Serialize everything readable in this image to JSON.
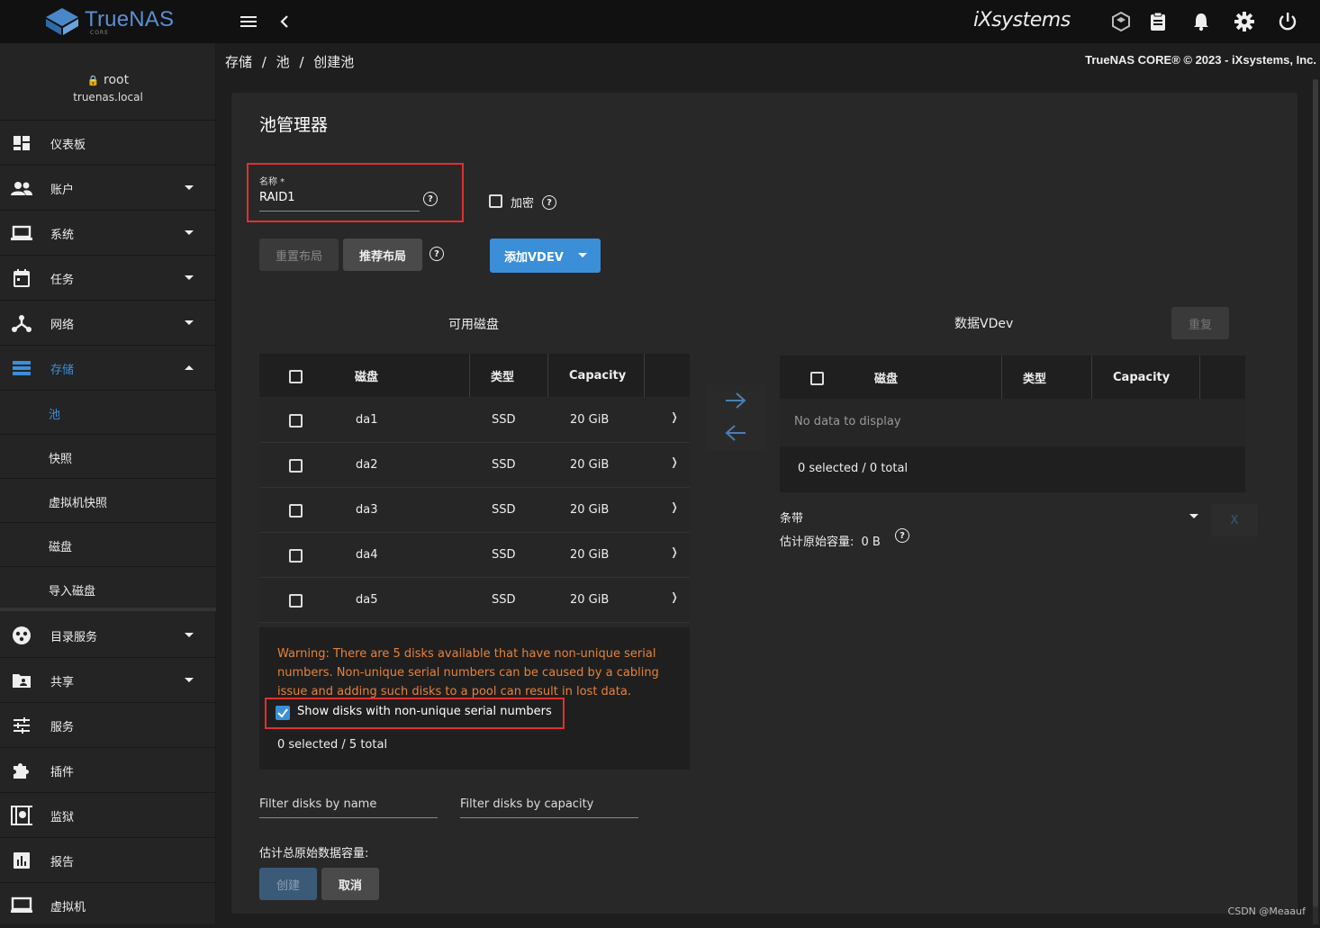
{
  "app": {
    "logo_text": "TrueNAS",
    "logo_sub": "CORE",
    "vendor_logo": "iXsystems",
    "copyright": "TrueNAS CORE® © 2023 - iXsystems, Inc."
  },
  "colors": {
    "accent": "#3b8fd9",
    "warning": "#e5823d",
    "highlight_box": "#e03030"
  },
  "topbar": {
    "icons": [
      "menu-icon",
      "chevron-left-icon",
      "truecommand-icon",
      "clipboard-icon",
      "bell-icon",
      "gear-icon",
      "power-icon"
    ]
  },
  "user": {
    "name": "root",
    "host": "truenas.local"
  },
  "sidebar": {
    "items": [
      {
        "label": "仪表板",
        "icon": "dashboard-icon",
        "expandable": false
      },
      {
        "label": "账户",
        "icon": "people-icon",
        "expandable": true
      },
      {
        "label": "系统",
        "icon": "laptop-icon",
        "expandable": true
      },
      {
        "label": "任务",
        "icon": "calendar-icon",
        "expandable": true
      },
      {
        "label": "网络",
        "icon": "network-icon",
        "expandable": true
      },
      {
        "label": "存储",
        "icon": "storage-icon",
        "expandable": true,
        "expanded": true
      }
    ],
    "storage_sub": [
      "池",
      "快照",
      "虚拟机快照",
      "磁盘",
      "导入磁盘"
    ],
    "items2": [
      {
        "label": "目录服务",
        "icon": "directory-icon",
        "expandable": true
      },
      {
        "label": "共享",
        "icon": "folder-share-icon",
        "expandable": true
      },
      {
        "label": "服务",
        "icon": "tune-icon",
        "expandable": false
      },
      {
        "label": "插件",
        "icon": "puzzle-icon",
        "expandable": false
      },
      {
        "label": "监狱",
        "icon": "jail-icon",
        "expandable": false
      },
      {
        "label": "报告",
        "icon": "chart-icon",
        "expandable": false
      },
      {
        "label": "虚拟机",
        "icon": "monitor-icon",
        "expandable": false
      }
    ]
  },
  "breadcrumb": {
    "parts": [
      "存储",
      "池",
      "创建池"
    ],
    "sep": "/"
  },
  "pool": {
    "title": "池管理器",
    "name_label": "名称 *",
    "name_value": "RAID1",
    "encrypt_label": "加密",
    "reset_layout": "重置布局",
    "suggest_layout": "推荐布局",
    "add_vdev": "添加VDEV"
  },
  "available": {
    "title": "可用磁盘",
    "headers": [
      "磁盘",
      "类型",
      "Capacity"
    ],
    "rows": [
      {
        "disk": "da1",
        "type": "SSD",
        "capacity": "20 GiB"
      },
      {
        "disk": "da2",
        "type": "SSD",
        "capacity": "20 GiB"
      },
      {
        "disk": "da3",
        "type": "SSD",
        "capacity": "20 GiB"
      },
      {
        "disk": "da4",
        "type": "SSD",
        "capacity": "20 GiB"
      },
      {
        "disk": "da5",
        "type": "SSD",
        "capacity": "20 GiB"
      }
    ],
    "warning": "Warning: There are 5 disks available that have non-unique serial numbers. Non-unique serial numbers can be caused by a cabling issue and adding such disks to a pool can result in lost data.",
    "show_nonunique_label": "Show disks with non-unique serial numbers",
    "show_nonunique_checked": true,
    "selected": "0 selected / 5 total",
    "filter_name": "Filter disks by name",
    "filter_capacity": "Filter disks by capacity"
  },
  "vdev": {
    "title": "数据VDev",
    "repeat": "重复",
    "headers": [
      "磁盘",
      "类型",
      "Capacity"
    ],
    "empty": "No data to display",
    "selected": "0 selected / 0 total",
    "layout": "条带",
    "raw_capacity_label": "估计原始容量:",
    "raw_capacity_value": "0 B",
    "remove": "X"
  },
  "footer": {
    "total_raw_label": "估计总原始数据容量:",
    "create": "创建",
    "cancel": "取消"
  },
  "watermark": "CSDN @Meaauf"
}
